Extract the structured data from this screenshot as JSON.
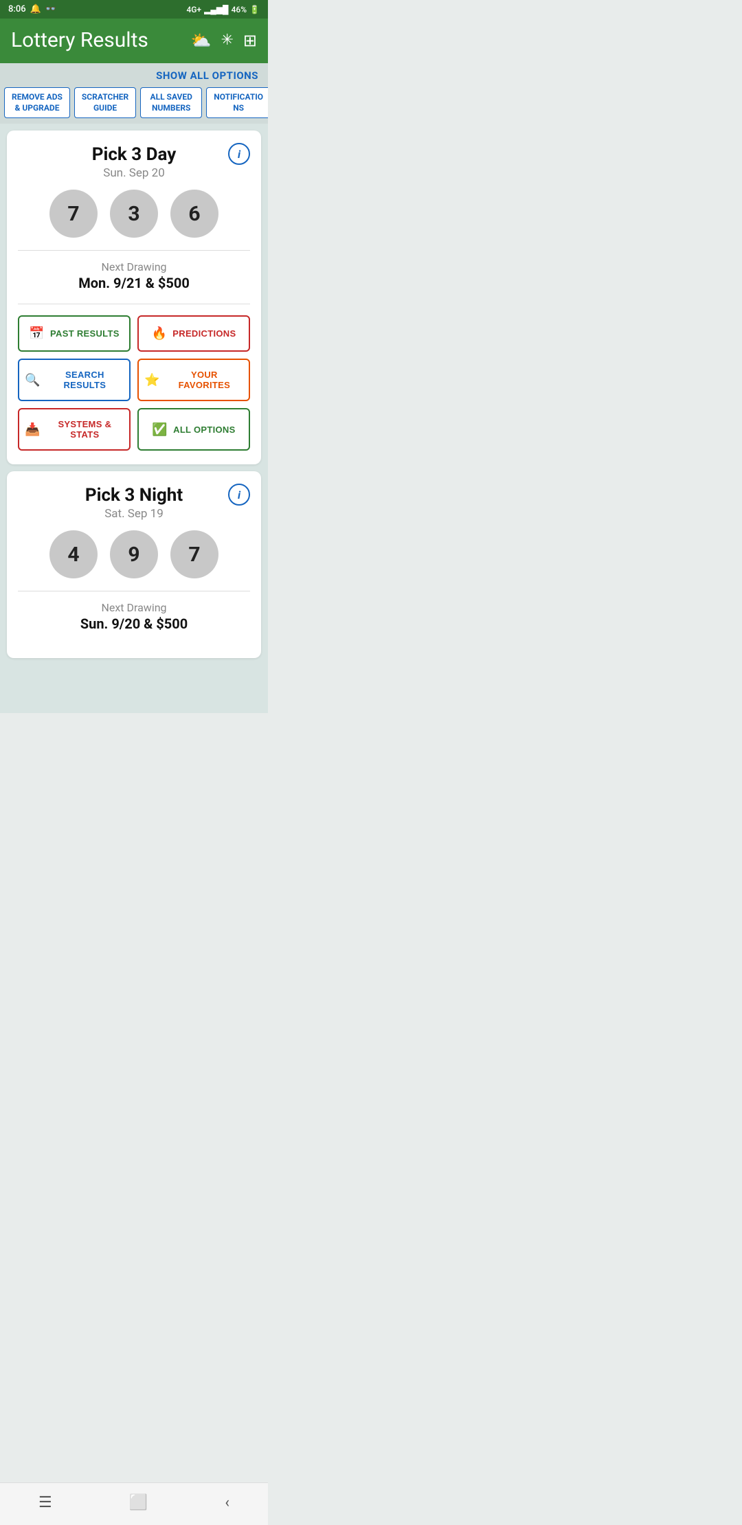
{
  "status_bar": {
    "time": "8:06",
    "signal": "4G+",
    "battery": "46%"
  },
  "header": {
    "title": "Lottery Results",
    "icons": [
      "cloud-snow-icon",
      "compass-icon",
      "grid-icon"
    ]
  },
  "show_all": {
    "label": "SHOW ALL OPTIONS"
  },
  "tabs": [
    {
      "id": "remove-ads",
      "label": "REMOVE ADS\n& UPGRADE"
    },
    {
      "id": "scratcher-guide",
      "label": "SCRATCHER\nGUIDE"
    },
    {
      "id": "all-saved-numbers",
      "label": "ALL SAVED\nNUMBERS"
    },
    {
      "id": "notifications",
      "label": "NOTIFICATIO\nNS"
    }
  ],
  "cards": [
    {
      "id": "pick3-day",
      "title": "Pick 3 Day",
      "date": "Sun. Sep 20",
      "numbers": [
        "7",
        "3",
        "6"
      ],
      "next_drawing_label": "Next Drawing",
      "next_drawing_value": "Mon. 9/21 & $500",
      "buttons": [
        {
          "id": "past-results",
          "icon": "📅",
          "label": "PAST RESULTS",
          "style": "btn-green"
        },
        {
          "id": "predictions",
          "icon": "🔥",
          "label": "PREDICTIONS",
          "style": "btn-red"
        },
        {
          "id": "search-results",
          "icon": "🔍",
          "label": "SEARCH RESULTS",
          "style": "btn-blue"
        },
        {
          "id": "your-favorites",
          "icon": "⭐",
          "label": "YOUR FAVORITES",
          "style": "btn-orange"
        },
        {
          "id": "systems-stats",
          "icon": "📥",
          "label": "SYSTEMS & STATS",
          "style": "btn-red"
        },
        {
          "id": "all-options",
          "icon": "✅",
          "label": "ALL OPTIONS",
          "style": "btn-green"
        }
      ]
    },
    {
      "id": "pick3-night",
      "title": "Pick 3 Night",
      "date": "Sat. Sep 19",
      "numbers": [
        "4",
        "9",
        "7"
      ],
      "next_drawing_label": "Next Drawing",
      "next_drawing_value": "Sun. 9/20 & $500"
    }
  ],
  "nav": {
    "buttons": [
      "menu-icon",
      "home-icon",
      "back-icon"
    ]
  }
}
